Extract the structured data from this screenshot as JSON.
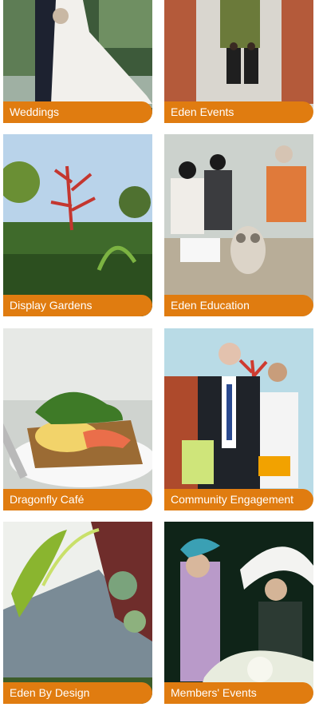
{
  "accent_color": "#e07c10",
  "tiles": [
    {
      "label": "Weddings"
    },
    {
      "label": "Eden Events"
    },
    {
      "label": "Display Gardens"
    },
    {
      "label": "Eden Education"
    },
    {
      "label": "Dragonfly Café"
    },
    {
      "label": "Community Engagement"
    },
    {
      "label": "Eden By Design"
    },
    {
      "label": "Members' Events"
    }
  ]
}
